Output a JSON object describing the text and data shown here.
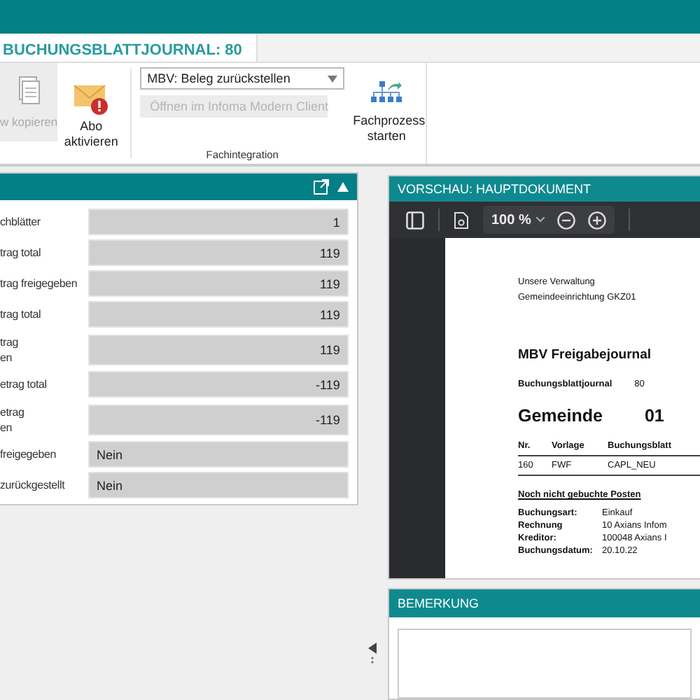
{
  "tab": {
    "label": "BUCHUNGSBLATTJOURNAL: 80",
    "selected": true
  },
  "ribbon": {
    "buttons": [
      {
        "label": "w kopieren",
        "kind": "copy",
        "disabled": true
      },
      {
        "label": "Abo aktivieren",
        "kind": "mail",
        "disabled": false
      }
    ],
    "dropdown": "MBV: Beleg zurückstellen",
    "open_button": {
      "label": "Öffnen im Infoma Modern Client",
      "disabled": true
    },
    "group_label": "Fachintegration",
    "process_button": "Fachprozess starten"
  },
  "fields": [
    {
      "label": "chblätter",
      "value": "1",
      "kind": "number"
    },
    {
      "label": "trag total",
      "value": "119",
      "kind": "number"
    },
    {
      "label": "trag freigegeben",
      "value": "119",
      "kind": "number"
    },
    {
      "label": "trag total",
      "value": "119",
      "kind": "number"
    },
    {
      "label": "trag\nen",
      "value": "119",
      "kind": "number"
    },
    {
      "label": "etrag total",
      "value": "-119",
      "kind": "number"
    },
    {
      "label": "etrag\nen",
      "value": "-119",
      "kind": "number"
    },
    {
      "label": "freigegeben",
      "value": "Nein",
      "kind": "text"
    },
    {
      "label": "zurückgestellt",
      "value": "Nein",
      "kind": "text"
    }
  ],
  "preview": {
    "title": "VORSCHAU: HAUPTDOKUMENT",
    "zoom": "100 %",
    "document": {
      "sender": [
        "Unsere Verwaltung",
        "Gemeindeeinrichtung GKZ01"
      ],
      "title": "MBV Freigabejournal",
      "journal_label": "Buchungsblattjournal",
      "journal_value": "80",
      "heading": "Gemeinde",
      "heading_value": "01",
      "columns": [
        "Nr.",
        "Vorlage",
        "Buchungsblatt"
      ],
      "rows": [
        [
          "160",
          "FWF",
          "CAPL_NEU"
        ]
      ],
      "section": "Noch nicht gebuchte Posten",
      "details": [
        {
          "key": "Buchungsart:",
          "value": "Einkauf"
        },
        {
          "key": "Rechnung",
          "value": "10 Axians Infom"
        },
        {
          "key": "Kreditor:",
          "value": "100048 Axians I"
        },
        {
          "key": "Buchungsdatum:",
          "value": "20.10.22"
        }
      ]
    }
  },
  "remark": {
    "title": "BEMERKUNG"
  }
}
